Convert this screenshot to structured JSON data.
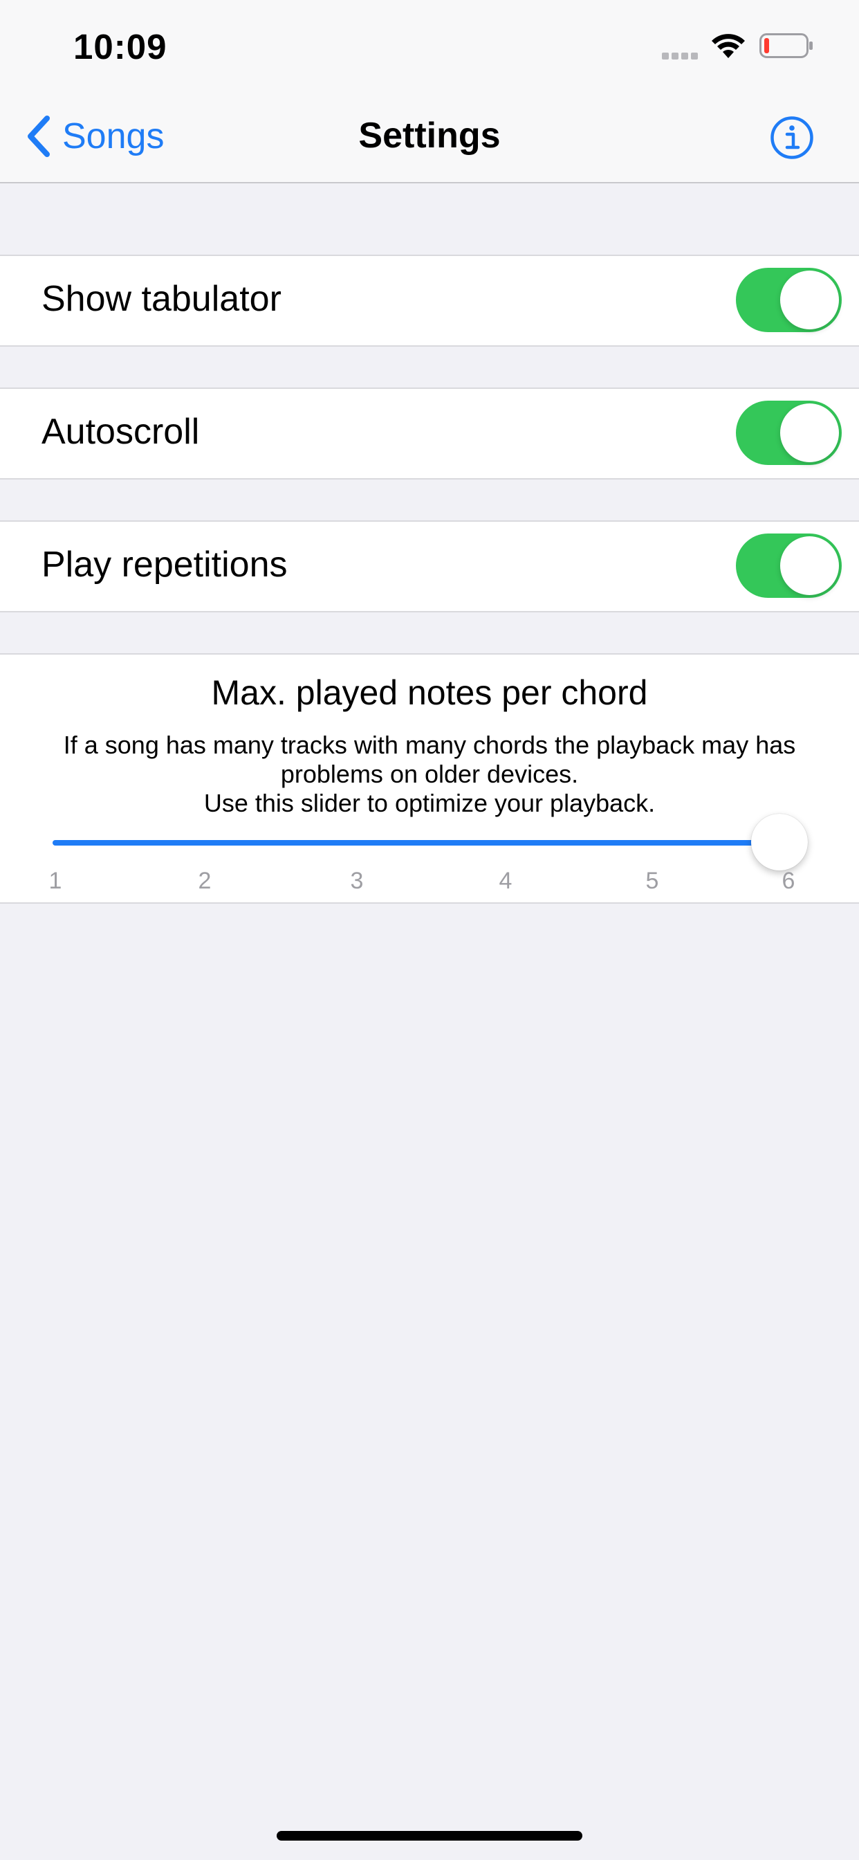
{
  "status_bar": {
    "time": "10:09",
    "icons": [
      "signal-icon",
      "wifi-icon",
      "battery-icon"
    ],
    "battery_color": "#ff3b30"
  },
  "nav_bar": {
    "back_label": "Songs",
    "title": "Settings",
    "info_icon": "info-icon"
  },
  "colors": {
    "accent": "#1f7cf6",
    "toggle_on": "#34c759",
    "background": "#f1f1f6"
  },
  "settings": [
    {
      "label": "Show tabulator",
      "enabled": true
    },
    {
      "label": "Autoscroll",
      "enabled": true
    },
    {
      "label": "Play repetitions",
      "enabled": true
    }
  ],
  "slider": {
    "title": "Max. played notes per chord",
    "description_lines": [
      "If a song has many tracks with many chords the playback may has",
      "problems on older devices.",
      "Use this slider to optimize your playback."
    ],
    "ticks": [
      "1",
      "2",
      "3",
      "4",
      "5",
      "6"
    ],
    "value": 6,
    "min": 1,
    "max": 6
  }
}
